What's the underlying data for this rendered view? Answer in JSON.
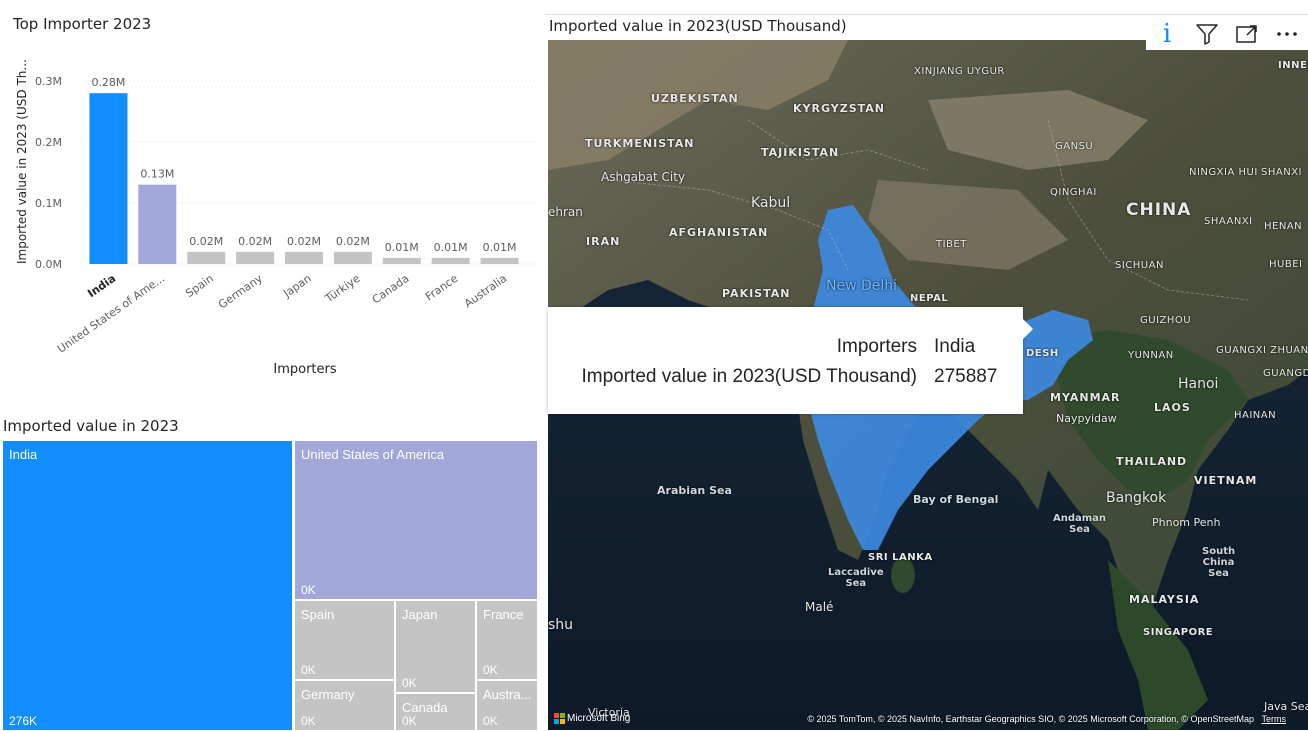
{
  "bar_chart": {
    "title": "Top Importer 2023",
    "chart_data": {
      "type": "bar",
      "title": "Top Importer 2023",
      "xlabel": "Importers",
      "ylabel": "Imported value in 2023 (USD Th...",
      "categories": [
        "India",
        "United States of Ame...",
        "Spain",
        "Germany",
        "Japan",
        "Türkiye",
        "Canada",
        "France",
        "Australia"
      ],
      "values": [
        0.28,
        0.13,
        0.02,
        0.02,
        0.02,
        0.02,
        0.01,
        0.01,
        0.01
      ],
      "data_labels": [
        "0.28M",
        "0.13M",
        "0.02M",
        "0.02M",
        "0.02M",
        "0.02M",
        "0.01M",
        "0.01M",
        "0.01M"
      ],
      "yticks": [
        "0.0M",
        "0.1M",
        "0.2M",
        "0.3M"
      ],
      "ytick_values": [
        0,
        0.1,
        0.2,
        0.3
      ],
      "ylim": [
        0,
        0.3
      ],
      "colors": [
        "#118dff",
        "#a1a8d9",
        "#c4c4c4",
        "#c4c4c4",
        "#c4c4c4",
        "#c4c4c4",
        "#c4c4c4",
        "#c4c4c4",
        "#c4c4c4"
      ],
      "grid": true
    }
  },
  "treemap": {
    "title": "Imported value in 2023",
    "tiles": [
      {
        "name": "India",
        "value": "276K",
        "color": "#118dff"
      },
      {
        "name": "United States of America",
        "value": "0K",
        "color": "#a1a8d9"
      },
      {
        "name": "Spain",
        "value": "0K",
        "color": "#c4c4c4"
      },
      {
        "name": "Japan",
        "value": "0K",
        "color": "#c4c4c4"
      },
      {
        "name": "France",
        "value": "0K",
        "color": "#c4c4c4"
      },
      {
        "name": "Germany",
        "value": "0K",
        "color": "#c4c4c4"
      },
      {
        "name": "Canada",
        "value": "0K",
        "color": "#c4c4c4"
      },
      {
        "name": "Austra...",
        "value": "0K",
        "color": "#c4c4c4"
      }
    ]
  },
  "map": {
    "title": "Imported value in 2023(USD Thousand)",
    "highlight_color": "#3d8be3",
    "labels": {
      "uzbekistan": "UZBEKISTAN",
      "kyrgyzstan": "KYRGYZSTAN",
      "xinjiang": "XINJIANG UYGUR",
      "turkmenistan": "TURKMENISTAN",
      "tajikistan": "TAJIKISTAN",
      "ashgabat": "Ashgabat City",
      "tehran": "ehran",
      "kabul": "Kabul",
      "afghanistan": "AFGHANISTAN",
      "iran": "IRAN",
      "pakistan": "PAKISTAN",
      "newdelhi": "New Delhi",
      "nepal": "NEPAL",
      "tibet": "TIBET",
      "china": "CHINA",
      "gansu": "GANSU",
      "qinghai": "QINGHAI",
      "ningxia": "NINGXIA\nHUI",
      "shanxi": "SHANXI",
      "shaanxi": "SHAANXI",
      "henan": "HENAN",
      "sichuan": "SICHUAN",
      "hubei": "HUBEI",
      "guizhou": "GUIZHOU",
      "yunnan": "YUNNAN",
      "guangxi": "GUANGXI\nZHUANG",
      "guangdong": "GUANGDO",
      "hanoi": "Hanoi",
      "myanmar": "MYANMAR",
      "naypyidaw": "Naypyidaw",
      "laos": "LAOS",
      "hainan": "HAINAN",
      "thailand": "THAILAND",
      "bangkok": "Bangkok",
      "vietnam": "VIETNAM",
      "phnompenh": "Phnom Penh",
      "arabiansea": "Arabian Sea",
      "bayofbengal": "Bay of Bengal",
      "andaman": "Andaman\nSea",
      "southchina": "South\nChina\nSea",
      "srilanka": "SRI LANKA",
      "laccadive": "Laccadive\nSea",
      "male": "Malé",
      "malaysia": "MALAYSIA",
      "singapore": "SINGAPORE",
      "shu": "shu",
      "victoria": "Victoria",
      "javasea": "Java Sea",
      "desh": "DESH",
      "inne": "INNE"
    },
    "attribution": "© 2025 TomTom, © 2025 NavInfo, Earthstar Geographics SIO, © 2025 Microsoft Corporation, © OpenStreetMap",
    "terms": "Terms",
    "bing_text": "Microsoft Bing",
    "toolbar": {
      "info_icon": "i",
      "filter_icon": "filter-icon",
      "focus_icon": "focus-mode-icon",
      "more_icon": "more-options-icon"
    },
    "tooltip": {
      "key1": "Importers",
      "val1": "India",
      "key2": "Imported value in 2023(USD Thousand)",
      "val2": "275887"
    }
  }
}
